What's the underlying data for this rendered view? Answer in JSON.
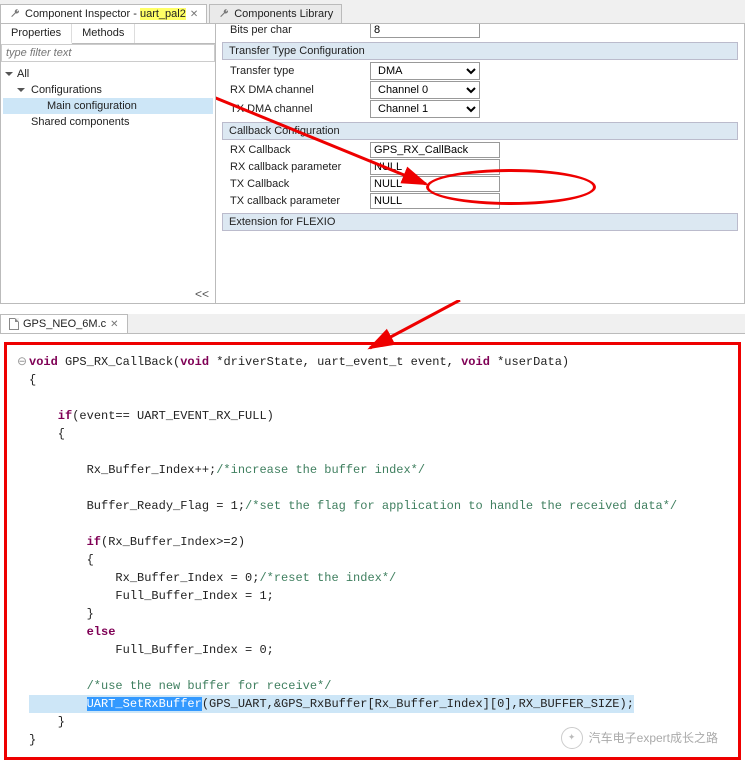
{
  "tabs": {
    "inspector_prefix": "Component Inspector - ",
    "inspector_name": "uart_pal2",
    "library": "Components Library"
  },
  "subtabs": {
    "properties": "Properties",
    "methods": "Methods"
  },
  "filter_placeholder": "type filter text",
  "tree": {
    "all": "All",
    "configs": "Configurations",
    "main": "Main configuration",
    "shared": "Shared components"
  },
  "collapse": "<<",
  "props": {
    "bits_per_char": {
      "label": "Bits per char",
      "value": "8"
    },
    "sect_transfer": "Transfer Type Configuration",
    "transfer_type": {
      "label": "Transfer type",
      "value": "DMA"
    },
    "rx_dma": {
      "label": "RX DMA channel",
      "value": "Channel 0"
    },
    "tx_dma": {
      "label": "TX DMA channel",
      "value": "Channel 1"
    },
    "sect_callback": "Callback Configuration",
    "rx_cb": {
      "label": "RX Callback",
      "value": "GPS_RX_CallBack"
    },
    "rx_cb_param": {
      "label": "RX callback parameter",
      "value": "NULL"
    },
    "tx_cb": {
      "label": "TX Callback",
      "value": "NULL"
    },
    "tx_cb_param": {
      "label": "TX callback parameter",
      "value": "NULL"
    },
    "sect_flexio": "Extension for FLEXIO"
  },
  "codefile": "GPS_NEO_6M.c",
  "code": {
    "l1a": "void",
    "l1b": " GPS_RX_CallBack(",
    "l1c": "void",
    "l1d": " *driverState, uart_event_t event, ",
    "l1e": "void",
    "l1f": " *userData)",
    "l2": "{",
    "l3a": "    if",
    "l3b": "(event== UART_EVENT_RX_FULL)",
    "l4": "    {",
    "l5a": "        Rx_Buffer_Index++;",
    "l5b": "/*increase the buffer index*/",
    "l6a": "        Buffer_Ready_Flag = 1;",
    "l6b": "/*set the flag for application to handle the received data*/",
    "l7a": "        if",
    "l7b": "(Rx_Buffer_Index>=2)",
    "l8": "        {",
    "l9a": "            Rx_Buffer_Index = 0;",
    "l9b": "/*reset the index*/",
    "l10": "            Full_Buffer_Index = 1;",
    "l11": "        }",
    "l12a": "        else",
    "l13": "            Full_Buffer_Index = 0;",
    "l14": "        /*use the new buffer for receive*/",
    "l15a": "        ",
    "l15b": "UART_SetRxBuffer",
    "l15c": "(GPS_UART,&GPS_RxBuffer[Rx_Buffer_Index][0],RX_BUFFER_SIZE);",
    "l16": "    }",
    "l17": "}"
  },
  "watermark": "汽车电子expert成长之路"
}
